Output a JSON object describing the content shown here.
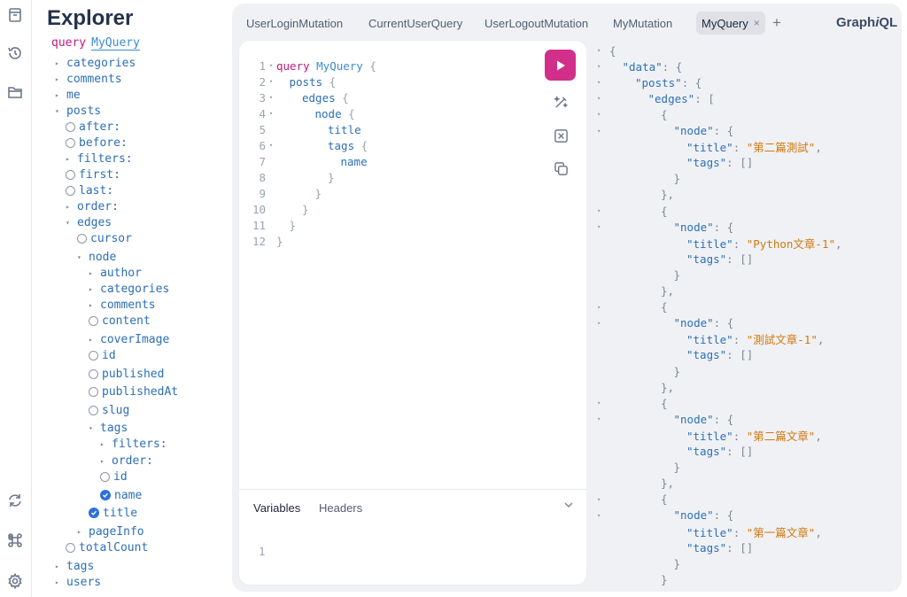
{
  "rail": {
    "icons": [
      "document-icon",
      "history-icon",
      "folder-icon",
      "refresh-icon",
      "command-icon",
      "settings-icon"
    ]
  },
  "explorer": {
    "title": "Explorer",
    "operation_keyword": "query",
    "operation_name": "MyQuery",
    "tree": [
      {
        "label": "categories",
        "kind": "caret"
      },
      {
        "label": "comments",
        "kind": "caret"
      },
      {
        "label": "me",
        "kind": "caret"
      },
      {
        "label": "posts",
        "kind": "open"
      },
      {
        "label": "after:",
        "kind": "circle"
      },
      {
        "label": "before:",
        "kind": "circle"
      },
      {
        "label": "filters:",
        "kind": "caret"
      },
      {
        "label": "first:",
        "kind": "circle"
      },
      {
        "label": "last:",
        "kind": "circle"
      },
      {
        "label": "order:",
        "kind": "caret"
      },
      {
        "label": "edges",
        "kind": "open"
      },
      {
        "label": "cursor",
        "kind": "circle"
      },
      {
        "label": "node",
        "kind": "open"
      },
      {
        "label": "author",
        "kind": "caret"
      },
      {
        "label": "categories",
        "kind": "caret"
      },
      {
        "label": "comments",
        "kind": "caret"
      },
      {
        "label": "content",
        "kind": "circle"
      },
      {
        "label": "coverImage",
        "kind": "caret"
      },
      {
        "label": "id",
        "kind": "circle"
      },
      {
        "label": "published",
        "kind": "circle"
      },
      {
        "label": "publishedAt",
        "kind": "circle"
      },
      {
        "label": "slug",
        "kind": "circle"
      },
      {
        "label": "tags",
        "kind": "open"
      },
      {
        "label": "filters:",
        "kind": "caret"
      },
      {
        "label": "order:",
        "kind": "caret"
      },
      {
        "label": "id",
        "kind": "circle"
      },
      {
        "label": "name",
        "kind": "checked"
      },
      {
        "label": "title",
        "kind": "checked"
      },
      {
        "label": "pageInfo",
        "kind": "caret"
      },
      {
        "label": "totalCount",
        "kind": "circle"
      },
      {
        "label": "tags",
        "kind": "caret"
      },
      {
        "label": "users",
        "kind": "caret"
      }
    ]
  },
  "tabs": [
    {
      "label": "UserLoginMutation"
    },
    {
      "label": "CurrentUserQuery"
    },
    {
      "label": "UserLogoutMutation"
    },
    {
      "label": "MyMutation"
    },
    {
      "label": "MyQuery",
      "close": "×"
    }
  ],
  "add_tab": "+",
  "brand": {
    "main": "Graph",
    "italic": "i",
    "tail": "QL"
  },
  "editor": {
    "lines": [
      {
        "n": "1",
        "fold": "▾",
        "kw": "query ",
        "qn": "MyQuery",
        "rest": " {"
      },
      {
        "n": "2",
        "fold": "▾",
        "fld": "posts",
        "rest": " {"
      },
      {
        "n": "3",
        "fold": "▾",
        "fld": "edges",
        "rest": " {"
      },
      {
        "n": "4",
        "fold": "▾",
        "fld": "node",
        "rest": " {"
      },
      {
        "n": "5",
        "fold": "",
        "fld": "title",
        "rest": ""
      },
      {
        "n": "6",
        "fold": "▾",
        "fld": "tags",
        "rest": " {"
      },
      {
        "n": "7",
        "fold": "",
        "fld": "name",
        "rest": ""
      },
      {
        "n": "8",
        "fold": "",
        "fld": "",
        "rest": "}"
      },
      {
        "n": "9",
        "fold": "",
        "fld": "",
        "rest": "}"
      },
      {
        "n": "10",
        "fold": "",
        "fld": "",
        "rest": "}"
      },
      {
        "n": "11",
        "fold": "",
        "fld": "",
        "rest": "}"
      },
      {
        "n": "12",
        "fold": "",
        "fld": "",
        "rest": "}"
      }
    ],
    "variables_tab": "Variables",
    "headers_tab": "Headers",
    "variables_line": "1"
  },
  "result": {
    "lines": [
      {
        "fold": "▾",
        "parts": [
          [
            "p",
            "{"
          ]
        ]
      },
      {
        "fold": "▾",
        "parts": [
          [
            "k",
            "\"data\""
          ],
          [
            "p",
            ": {"
          ]
        ]
      },
      {
        "fold": "▾",
        "parts": [
          [
            "k",
            "\"posts\""
          ],
          [
            "p",
            ": {"
          ]
        ]
      },
      {
        "fold": "▾",
        "parts": [
          [
            "k",
            "\"edges\""
          ],
          [
            "p",
            ": ["
          ]
        ]
      },
      {
        "fold": "▾",
        "parts": [
          [
            "p",
            "{"
          ]
        ]
      },
      {
        "fold": "▾",
        "parts": [
          [
            "k",
            "\"node\""
          ],
          [
            "p",
            ": {"
          ]
        ]
      },
      {
        "fold": "",
        "parts": [
          [
            "k",
            "\"title\""
          ],
          [
            "p",
            ": "
          ],
          [
            "s",
            "\"第二篇測試\""
          ],
          [
            "p",
            ","
          ]
        ]
      },
      {
        "fold": "",
        "parts": [
          [
            "k",
            "\"tags\""
          ],
          [
            "p",
            ": []"
          ]
        ]
      },
      {
        "fold": "",
        "parts": [
          [
            "p",
            "}"
          ]
        ]
      },
      {
        "fold": "",
        "parts": [
          [
            "p",
            "},"
          ]
        ]
      },
      {
        "fold": "▾",
        "parts": [
          [
            "p",
            "{"
          ]
        ]
      },
      {
        "fold": "▾",
        "parts": [
          [
            "k",
            "\"node\""
          ],
          [
            "p",
            ": {"
          ]
        ]
      },
      {
        "fold": "",
        "parts": [
          [
            "k",
            "\"title\""
          ],
          [
            "p",
            ": "
          ],
          [
            "s",
            "\"Python文章-1\""
          ],
          [
            "p",
            ","
          ]
        ]
      },
      {
        "fold": "",
        "parts": [
          [
            "k",
            "\"tags\""
          ],
          [
            "p",
            ": []"
          ]
        ]
      },
      {
        "fold": "",
        "parts": [
          [
            "p",
            "}"
          ]
        ]
      },
      {
        "fold": "",
        "parts": [
          [
            "p",
            "},"
          ]
        ]
      },
      {
        "fold": "▾",
        "parts": [
          [
            "p",
            "{"
          ]
        ]
      },
      {
        "fold": "▾",
        "parts": [
          [
            "k",
            "\"node\""
          ],
          [
            "p",
            ": {"
          ]
        ]
      },
      {
        "fold": "",
        "parts": [
          [
            "k",
            "\"title\""
          ],
          [
            "p",
            ": "
          ],
          [
            "s",
            "\"測試文章-1\""
          ],
          [
            "p",
            ","
          ]
        ]
      },
      {
        "fold": "",
        "parts": [
          [
            "k",
            "\"tags\""
          ],
          [
            "p",
            ": []"
          ]
        ]
      },
      {
        "fold": "",
        "parts": [
          [
            "p",
            "}"
          ]
        ]
      },
      {
        "fold": "",
        "parts": [
          [
            "p",
            "},"
          ]
        ]
      },
      {
        "fold": "▾",
        "parts": [
          [
            "p",
            "{"
          ]
        ]
      },
      {
        "fold": "▾",
        "parts": [
          [
            "k",
            "\"node\""
          ],
          [
            "p",
            ": {"
          ]
        ]
      },
      {
        "fold": "",
        "parts": [
          [
            "k",
            "\"title\""
          ],
          [
            "p",
            ": "
          ],
          [
            "s",
            "\"第二篇文章\""
          ],
          [
            "p",
            ","
          ]
        ]
      },
      {
        "fold": "",
        "parts": [
          [
            "k",
            "\"tags\""
          ],
          [
            "p",
            ": []"
          ]
        ]
      },
      {
        "fold": "",
        "parts": [
          [
            "p",
            "}"
          ]
        ]
      },
      {
        "fold": "",
        "parts": [
          [
            "p",
            "},"
          ]
        ]
      },
      {
        "fold": "▾",
        "parts": [
          [
            "p",
            "{"
          ]
        ]
      },
      {
        "fold": "▾",
        "parts": [
          [
            "k",
            "\"node\""
          ],
          [
            "p",
            ": {"
          ]
        ]
      },
      {
        "fold": "",
        "parts": [
          [
            "k",
            "\"title\""
          ],
          [
            "p",
            ": "
          ],
          [
            "s",
            "\"第一篇文章\""
          ],
          [
            "p",
            ","
          ]
        ]
      },
      {
        "fold": "",
        "parts": [
          [
            "k",
            "\"tags\""
          ],
          [
            "p",
            ": []"
          ]
        ]
      },
      {
        "fold": "",
        "parts": [
          [
            "p",
            "}"
          ]
        ]
      },
      {
        "fold": "",
        "parts": [
          [
            "p",
            "}"
          ]
        ]
      }
    ]
  }
}
